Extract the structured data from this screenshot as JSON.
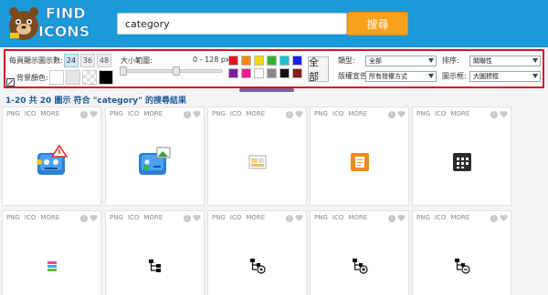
{
  "header": {
    "logo_text_1": "FIND",
    "logo_text_2": "ICONS",
    "search_value": "category",
    "search_button": "搜尋"
  },
  "filters": {
    "per_page_label": "每頁顯示圖示數:",
    "per_page_options": [
      "24",
      "36",
      "48"
    ],
    "per_page_selected": "24",
    "bg_color_label": "背景顏色:",
    "size_range_label": "大小範圍:",
    "size_range_value": "0 - 128 px",
    "colors_row1": [
      "#e8141c",
      "#f9870d",
      "#f6d80d",
      "#2fb52b",
      "#15c4cc",
      "#1722e6"
    ],
    "colors_row2": [
      "#7b1fa2",
      "#e91e8c",
      "#ffffff",
      "#8a8a8a",
      "#111111",
      "#8b1a1a"
    ],
    "all_button": "全部",
    "type_label": "類型:",
    "type_value": "全部",
    "license_label": "版權宣告:",
    "license_value": "所有授權方式",
    "sort_label": "排序:",
    "sort_value": "關聯性",
    "view_label": "圖示框:",
    "view_value": "大圖標框"
  },
  "results_text": "1-20 共 20 圖示 符合 \"category\" 的搜尋結果",
  "card_tabs": [
    "PNG",
    "ICO",
    "MORE"
  ],
  "cards": [
    {
      "icon": "blue-face-warning-icon"
    },
    {
      "icon": "blue-face-image-icon"
    },
    {
      "icon": "folder-image-icon"
    },
    {
      "icon": "orange-document-icon"
    },
    {
      "icon": "dark-calendar-grid-icon"
    },
    {
      "icon": "color-stack-icon"
    },
    {
      "icon": "hierarchy-icon"
    },
    {
      "icon": "hierarchy-settings-icon"
    },
    {
      "icon": "hierarchy-add-icon"
    },
    {
      "icon": "hierarchy-remove-icon"
    }
  ]
}
